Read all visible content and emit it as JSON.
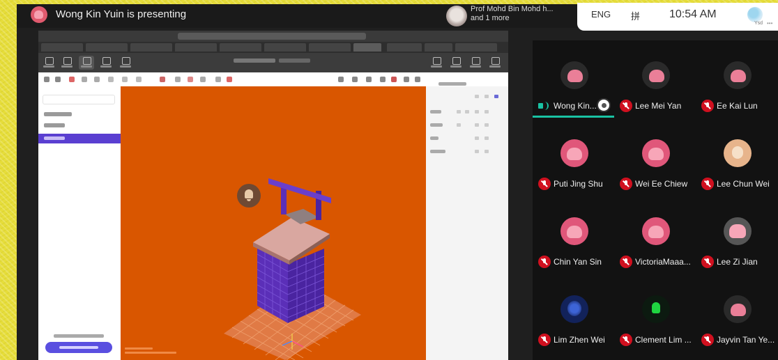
{
  "meet": {
    "presenting_text": "Wong Kin Yuin is presenting",
    "pinned_name": "Prof Mohd Bin Mohd h...",
    "pinned_more": "and 1 more",
    "status_lang": "ENG",
    "status_ime": "拼",
    "clock": "10:54 AM",
    "weather_label": "Ysd"
  },
  "participants": [
    {
      "name": "Wong Kin...",
      "mic": "on",
      "avatar": "dark",
      "speaking": true,
      "presenting": true
    },
    {
      "name": "Lee Mei Yan",
      "mic": "off",
      "avatar": "dark"
    },
    {
      "name": "Ee Kai Lun",
      "mic": "off",
      "avatar": "dark"
    },
    {
      "name": "Puti Jing Shu",
      "mic": "off",
      "avatar": "pink"
    },
    {
      "name": "Wei Ee Chiew",
      "mic": "off",
      "avatar": "pink"
    },
    {
      "name": "Lee Chun Wei",
      "mic": "off",
      "avatar": "brown"
    },
    {
      "name": "Chin Yan Sin",
      "mic": "off",
      "avatar": "pink"
    },
    {
      "name": "VictoriaMaaa...",
      "mic": "off",
      "avatar": "pink"
    },
    {
      "name": "Lee Zi Jian",
      "mic": "off",
      "avatar": "gray"
    },
    {
      "name": "Lim Zhen Wei",
      "mic": "off",
      "avatar": "blue"
    },
    {
      "name": "Clement Lim ...",
      "mic": "off",
      "avatar": "green"
    },
    {
      "name": "Jayvin Tan Ye...",
      "mic": "off",
      "avatar": "dark"
    }
  ],
  "colors": {
    "viewport": "#d95600",
    "model_purple": "#5b2fb8",
    "selected_row": "#5a3fd1",
    "speaking": "#19c2a3",
    "mic_off": "#d0101f"
  }
}
